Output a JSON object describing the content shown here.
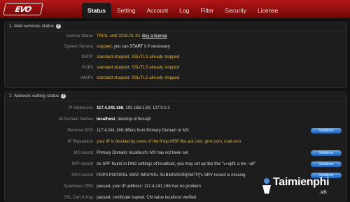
{
  "logo": "EVO",
  "tabs": [
    {
      "label": "Status",
      "active": true
    },
    {
      "label": "Setting",
      "active": false
    },
    {
      "label": "Account",
      "active": false
    },
    {
      "label": "Log",
      "active": false
    },
    {
      "label": "Filter",
      "active": false
    },
    {
      "label": "Security",
      "active": false
    },
    {
      "label": "License",
      "active": false
    }
  ],
  "mail": {
    "title": "1. Mail services status",
    "rows": [
      {
        "label": "License Status",
        "value": "TRIAL until 2018-01-30,",
        "link": "Buy a license"
      },
      {
        "label": "System Service",
        "value_warn": "stopped",
        "value_rest": ", you can",
        "link": "START",
        "value_tail": "it if necessary"
      },
      {
        "label": "SMTP",
        "value": "standard stopped, SSL/TLS already stopped"
      },
      {
        "label": "POP3",
        "value": "standard stopped, SSL/TLS already stopped"
      },
      {
        "label": "IMAP4",
        "value": "standard stopped, SSL/TLS already stopped"
      }
    ]
  },
  "network": {
    "title": "2. Network setting status",
    "button_label": "Solutions",
    "rows": [
      {
        "label": "IP Addresses",
        "strong": "117.4.241.166",
        "value": ", 192.168.1.50, 127.0.0.1"
      },
      {
        "label": "All Domain Names",
        "strong": "localhost",
        "value": ", desktop-m7kcuq9"
      },
      {
        "label": "Reverse DNS",
        "value": "117.4.241.166 differs from Primary Domain or MX"
      },
      {
        "label": "IP Reputation",
        "value": "your IP is blocked by some of the 8 top MSP like aol.com, gmx.com, mail.com"
      },
      {
        "label": "MX record",
        "value": "Primary Domain: localhost's MX has not been set"
      },
      {
        "label": "SPF record",
        "value": "no SPF found in DNS settings of localhost, you may set up like this \"v=spf1 a mx ~all\""
      },
      {
        "label": "SRV record",
        "value": "POP3 POP3SSL IMAP IMAPSSL SUBMISSION[SMTP]'s SRV record is missing"
      },
      {
        "label": "Spamhaus ZEN",
        "value": "passed, your IP address: 117.4.241.166 has no problem"
      },
      {
        "label": "SSL Cert & Key",
        "value": "passed, certificate loaded, CN value localhost verified"
      }
    ]
  },
  "watermark": {
    "brand": "Taimienphi",
    "tld": ".vn"
  }
}
